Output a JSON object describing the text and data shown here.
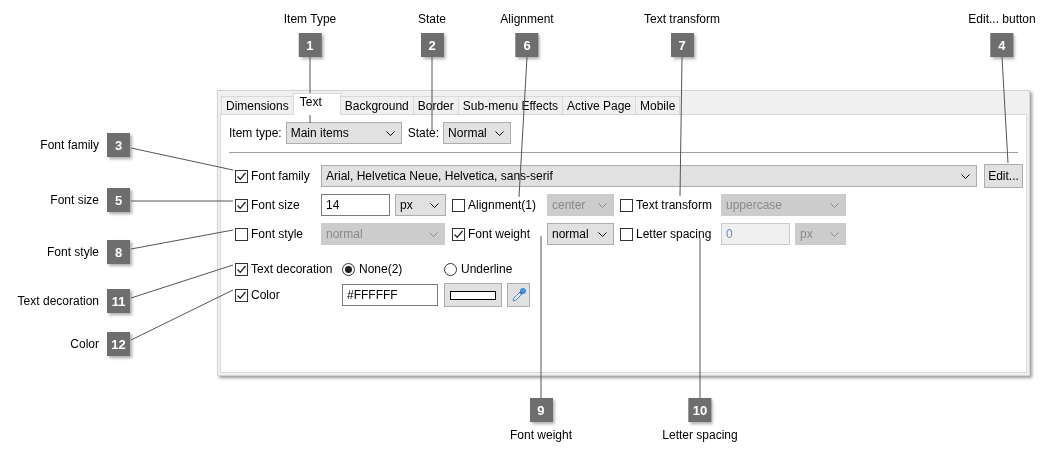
{
  "callouts": [
    {
      "number": "1",
      "label": "Item Type"
    },
    {
      "number": "2",
      "label": "State"
    },
    {
      "number": "6",
      "label": "Alignment"
    },
    {
      "number": "7",
      "label": "Text transform"
    },
    {
      "number": "4",
      "label": "Edit... button"
    },
    {
      "number": "3",
      "label": "Font family"
    },
    {
      "number": "5",
      "label": "Font size"
    },
    {
      "number": "8",
      "label": "Font style"
    },
    {
      "number": "11",
      "label": "Text decoration"
    },
    {
      "number": "12",
      "label": "Color"
    },
    {
      "number": "9",
      "label": "Font weight"
    },
    {
      "number": "10",
      "label": "Letter spacing"
    }
  ],
  "dialog": {
    "tabs": [
      {
        "label": "Dimensions",
        "selected": false
      },
      {
        "label": "Text",
        "selected": true
      },
      {
        "label": "Background",
        "selected": false
      },
      {
        "label": "Border",
        "selected": false
      },
      {
        "label": "Sub-menu Effects",
        "selected": false
      },
      {
        "label": "Active Page",
        "selected": false
      },
      {
        "label": "Mobile",
        "selected": false
      }
    ],
    "item_type": {
      "label": "Item type:",
      "value": "Main items"
    },
    "state": {
      "label": "State:",
      "value": "Normal"
    },
    "rows": [
      [
        {
          "kind": "checkbox",
          "label": "Font family",
          "checked": true
        },
        {
          "kind": "dropdown",
          "value": "Arial, Helvetica Neue, Helvetica, sans-serif",
          "disabled": false
        },
        {
          "kind": "button",
          "label": "Edit..."
        }
      ],
      [
        {
          "kind": "checkbox",
          "label": "Font size",
          "checked": true
        },
        {
          "kind": "input_unit",
          "value": "14",
          "unit": "px",
          "disabled": false
        },
        {
          "kind": "checkbox",
          "label": "Alignment(1)",
          "checked": false
        },
        {
          "kind": "dropdown",
          "value": "center",
          "disabled": true
        },
        {
          "kind": "checkbox",
          "label": "Text transform",
          "checked": false
        },
        {
          "kind": "dropdown",
          "value": "uppercase",
          "disabled": true
        }
      ],
      [
        {
          "kind": "checkbox",
          "label": "Font style",
          "checked": false
        },
        {
          "kind": "dropdown",
          "value": "normal",
          "disabled": true
        },
        {
          "kind": "checkbox",
          "label": "Font weight",
          "checked": true
        },
        {
          "kind": "dropdown",
          "value": "normal",
          "disabled": false
        },
        {
          "kind": "checkbox",
          "label": "Letter spacing",
          "checked": false
        },
        {
          "kind": "input_unit",
          "value": "0",
          "unit": "px",
          "disabled": true
        }
      ],
      [
        {
          "kind": "checkbox",
          "label": "Text decoration",
          "checked": true
        },
        {
          "kind": "radio",
          "label": "None(2)",
          "selected": true
        },
        {
          "kind": "radio",
          "label": "Underline",
          "selected": false
        }
      ],
      [
        {
          "kind": "checkbox",
          "label": "Color",
          "checked": true
        },
        {
          "kind": "input",
          "value": "#FFFFFF",
          "disabled": false
        },
        {
          "kind": "swatch"
        },
        {
          "kind": "picker"
        }
      ]
    ]
  }
}
